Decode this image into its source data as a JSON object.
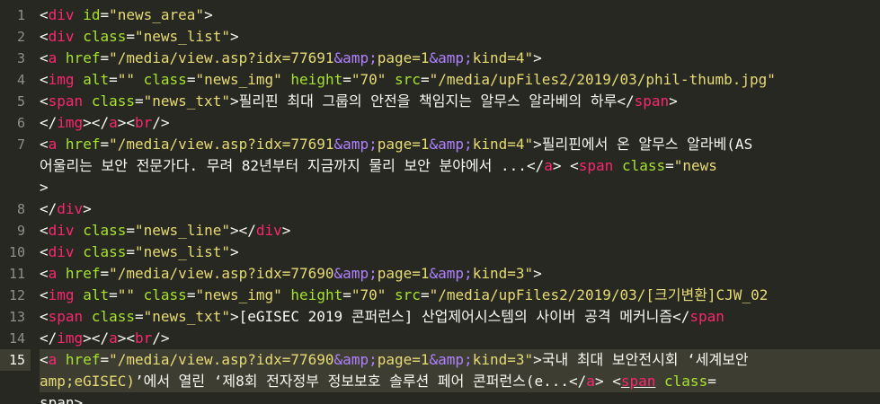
{
  "editor": {
    "theme_colors": {
      "background": "#272822",
      "tag": "#f92672",
      "attribute": "#a6e22e",
      "string": "#e6db74",
      "text": "#f8f8f2",
      "line_number": "#8f908a",
      "active_line": "#3e3d32"
    },
    "active_line_number": "15",
    "lines": [
      {
        "num": "1",
        "tokens": [
          [
            "p",
            "<"
          ],
          [
            "tag",
            "div"
          ],
          [
            "t",
            " "
          ],
          [
            "attr",
            "id"
          ],
          [
            "p",
            "="
          ],
          [
            "str",
            "\"news_area\""
          ],
          [
            "p",
            ">"
          ]
        ]
      },
      {
        "num": "2",
        "tokens": [
          [
            "p",
            "<"
          ],
          [
            "tag",
            "div"
          ],
          [
            "t",
            " "
          ],
          [
            "attr",
            "class"
          ],
          [
            "p",
            "="
          ],
          [
            "str",
            "\"news_list\""
          ],
          [
            "p",
            ">"
          ]
        ]
      },
      {
        "num": "3",
        "tokens": [
          [
            "p",
            "<"
          ],
          [
            "tag",
            "a"
          ],
          [
            "t",
            " "
          ],
          [
            "attr",
            "href"
          ],
          [
            "p",
            "="
          ],
          [
            "str",
            "\"/media/view.asp?idx=77691"
          ],
          [
            "ent",
            "&amp;"
          ],
          [
            "str",
            "page=1"
          ],
          [
            "ent",
            "&amp;"
          ],
          [
            "str",
            "kind=4\""
          ],
          [
            "p",
            ">"
          ]
        ]
      },
      {
        "num": "4",
        "tokens": [
          [
            "p",
            "<"
          ],
          [
            "tag",
            "img"
          ],
          [
            "t",
            " "
          ],
          [
            "attr",
            "alt"
          ],
          [
            "p",
            "="
          ],
          [
            "str",
            "\"\""
          ],
          [
            "t",
            " "
          ],
          [
            "attr",
            "class"
          ],
          [
            "p",
            "="
          ],
          [
            "str",
            "\"news_img\""
          ],
          [
            "t",
            " "
          ],
          [
            "attr",
            "height"
          ],
          [
            "p",
            "="
          ],
          [
            "str",
            "\"70\""
          ],
          [
            "t",
            " "
          ],
          [
            "attr",
            "src"
          ],
          [
            "p",
            "="
          ],
          [
            "str",
            "\"/media/upFiles2/2019/03/phil-thumb.jpg\""
          ]
        ]
      },
      {
        "num": "5",
        "tokens": [
          [
            "p",
            "<"
          ],
          [
            "tag",
            "span"
          ],
          [
            "t",
            " "
          ],
          [
            "attr",
            "class"
          ],
          [
            "p",
            "="
          ],
          [
            "str",
            "\"news_txt\""
          ],
          [
            "p",
            ">"
          ],
          [
            "t",
            "필리핀 최대 그룹의 안전을 책임지는 알무스 알라베의 하루"
          ],
          [
            "p",
            "</"
          ],
          [
            "tag",
            "span"
          ],
          [
            "p",
            ">"
          ]
        ]
      },
      {
        "num": "6",
        "tokens": [
          [
            "p",
            "</"
          ],
          [
            "tag",
            "img"
          ],
          [
            "p",
            "></"
          ],
          [
            "tag",
            "a"
          ],
          [
            "p",
            "><"
          ],
          [
            "tag",
            "br"
          ],
          [
            "p",
            "/>"
          ]
        ]
      },
      {
        "num": "7",
        "tokens": [
          [
            "p",
            "<"
          ],
          [
            "tag",
            "a"
          ],
          [
            "t",
            " "
          ],
          [
            "attr",
            "href"
          ],
          [
            "p",
            "="
          ],
          [
            "str",
            "\"/media/view.asp?idx=77691"
          ],
          [
            "ent",
            "&amp;"
          ],
          [
            "str",
            "page=1"
          ],
          [
            "ent",
            "&amp;"
          ],
          [
            "str",
            "kind=4\""
          ],
          [
            "p",
            ">"
          ],
          [
            "t",
            "필리핀에서 온 알무스 알라베(AS"
          ]
        ]
      },
      {
        "num": "",
        "tokens": [
          [
            "t",
            "어울리는 보안 전문가다. 무려 82년부터 지금까지 물리 보안 분야에서 ..."
          ],
          [
            "p",
            "</"
          ],
          [
            "tag",
            "a"
          ],
          [
            "p",
            ">"
          ],
          [
            "t",
            " "
          ],
          [
            "p",
            "<"
          ],
          [
            "tag",
            "span"
          ],
          [
            "t",
            " "
          ],
          [
            "attr",
            "class"
          ],
          [
            "p",
            "="
          ],
          [
            "str",
            "\"news"
          ]
        ]
      },
      {
        "num": "",
        "tokens": [
          [
            "p",
            ">"
          ]
        ]
      },
      {
        "num": "8",
        "tokens": [
          [
            "p",
            "</"
          ],
          [
            "tag",
            "div"
          ],
          [
            "p",
            ">"
          ]
        ]
      },
      {
        "num": "9",
        "tokens": [
          [
            "p",
            "<"
          ],
          [
            "tag",
            "div"
          ],
          [
            "t",
            " "
          ],
          [
            "attr",
            "class"
          ],
          [
            "p",
            "="
          ],
          [
            "str",
            "\"news_line\""
          ],
          [
            "p",
            "></"
          ],
          [
            "tag",
            "div"
          ],
          [
            "p",
            ">"
          ]
        ]
      },
      {
        "num": "10",
        "tokens": [
          [
            "p",
            "<"
          ],
          [
            "tag",
            "div"
          ],
          [
            "t",
            " "
          ],
          [
            "attr",
            "class"
          ],
          [
            "p",
            "="
          ],
          [
            "str",
            "\"news_list\""
          ],
          [
            "p",
            ">"
          ]
        ]
      },
      {
        "num": "11",
        "tokens": [
          [
            "p",
            "<"
          ],
          [
            "tag",
            "a"
          ],
          [
            "t",
            " "
          ],
          [
            "attr",
            "href"
          ],
          [
            "p",
            "="
          ],
          [
            "str",
            "\"/media/view.asp?idx=77690"
          ],
          [
            "ent",
            "&amp;"
          ],
          [
            "str",
            "page=1"
          ],
          [
            "ent",
            "&amp;"
          ],
          [
            "str",
            "kind=3\""
          ],
          [
            "p",
            ">"
          ]
        ]
      },
      {
        "num": "12",
        "tokens": [
          [
            "p",
            "<"
          ],
          [
            "tag",
            "img"
          ],
          [
            "t",
            " "
          ],
          [
            "attr",
            "alt"
          ],
          [
            "p",
            "="
          ],
          [
            "str",
            "\"\""
          ],
          [
            "t",
            " "
          ],
          [
            "attr",
            "class"
          ],
          [
            "p",
            "="
          ],
          [
            "str",
            "\"news_img\""
          ],
          [
            "t",
            " "
          ],
          [
            "attr",
            "height"
          ],
          [
            "p",
            "="
          ],
          [
            "str",
            "\"70\""
          ],
          [
            "t",
            " "
          ],
          [
            "attr",
            "src"
          ],
          [
            "p",
            "="
          ],
          [
            "str",
            "\"/media/upFiles2/2019/03/[크기변환]CJW_02"
          ]
        ]
      },
      {
        "num": "13",
        "tokens": [
          [
            "p",
            "<"
          ],
          [
            "tag",
            "span"
          ],
          [
            "t",
            " "
          ],
          [
            "attr",
            "class"
          ],
          [
            "p",
            "="
          ],
          [
            "str",
            "\"news_txt\""
          ],
          [
            "p",
            ">"
          ],
          [
            "t",
            "[eGISEC 2019 콘퍼런스] 산업제어시스템의 사이버 공격 메커니즘"
          ],
          [
            "p",
            "</"
          ],
          [
            "tag",
            "span"
          ]
        ]
      },
      {
        "num": "14",
        "tokens": [
          [
            "p",
            "</"
          ],
          [
            "tag",
            "img"
          ],
          [
            "p",
            "></"
          ],
          [
            "tag",
            "a"
          ],
          [
            "p",
            "><"
          ],
          [
            "tag",
            "br"
          ],
          [
            "p",
            "/>"
          ]
        ]
      },
      {
        "num": "15",
        "tokens": [
          [
            "p",
            "<"
          ],
          [
            "tag",
            "a"
          ],
          [
            "t",
            " "
          ],
          [
            "attr",
            "href"
          ],
          [
            "p",
            "="
          ],
          [
            "str",
            "\"/media/view.asp?idx=77690"
          ],
          [
            "ent",
            "&amp;"
          ],
          [
            "str",
            "page=1"
          ],
          [
            "ent",
            "&amp;"
          ],
          [
            "str",
            "kind=3\""
          ],
          [
            "p",
            ">"
          ],
          [
            "t",
            "국내 최대 보안전시회 ‘세계보안"
          ]
        ]
      },
      {
        "num": "",
        "tokens": [
          [
            "str",
            "amp;eGISEC)"
          ],
          [
            "t",
            "’에서 열린 ‘제8회 전자정부 정보보호 솔루션 페어 콘퍼런스(e..."
          ],
          [
            "p",
            "</"
          ],
          [
            "tag",
            "a"
          ],
          [
            "p",
            ">"
          ],
          [
            "t",
            " "
          ],
          [
            "p",
            "<"
          ],
          [
            "tagu",
            "span"
          ],
          [
            "t",
            " "
          ],
          [
            "attr",
            "class"
          ],
          [
            "p",
            "="
          ]
        ]
      },
      {
        "num": "",
        "tokens": [
          [
            "t",
            "span>"
          ]
        ]
      }
    ]
  }
}
